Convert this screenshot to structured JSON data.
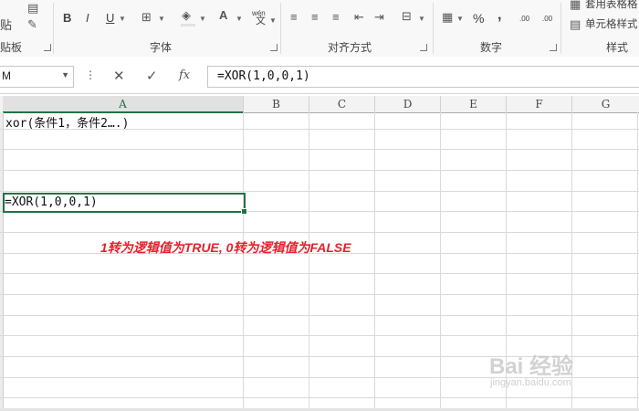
{
  "ribbon": {
    "paste_label": "贴",
    "groups": {
      "clipboard": "贴板",
      "font": "字体",
      "alignment": "对齐方式",
      "number": "数字",
      "styles": "样式"
    },
    "font_buttons": {
      "bold": "B",
      "italic": "I",
      "underline": "U"
    },
    "phonetic_label": "wén",
    "phonetic_sub": "文",
    "percent": "%",
    "comma": ",",
    "dec_increase": ".00",
    "dec_decrease": ".00",
    "table_format": "套用表格格",
    "cell_styles": "单元格样式"
  },
  "formula_bar": {
    "name_box": "M",
    "cancel_icon": "✕",
    "enter_icon": "✓",
    "fx_label": "fx",
    "formula": "=XOR(1,0,0,1)"
  },
  "grid": {
    "columns": [
      "A",
      "B",
      "C",
      "D",
      "E",
      "F",
      "G"
    ],
    "active_column": "A",
    "cells": {
      "a1": "xor(条件1，条件2….)",
      "a5": "=XOR(1,0,0,1)"
    }
  },
  "annotation": "1转为逻辑值为TRUE, 0转为逻辑值为FALSE",
  "watermark": {
    "main": "Bai 经验",
    "sub": "jingyan.baidu.com"
  },
  "colors": {
    "accent": "#217346",
    "annotation": "#e8202c"
  }
}
